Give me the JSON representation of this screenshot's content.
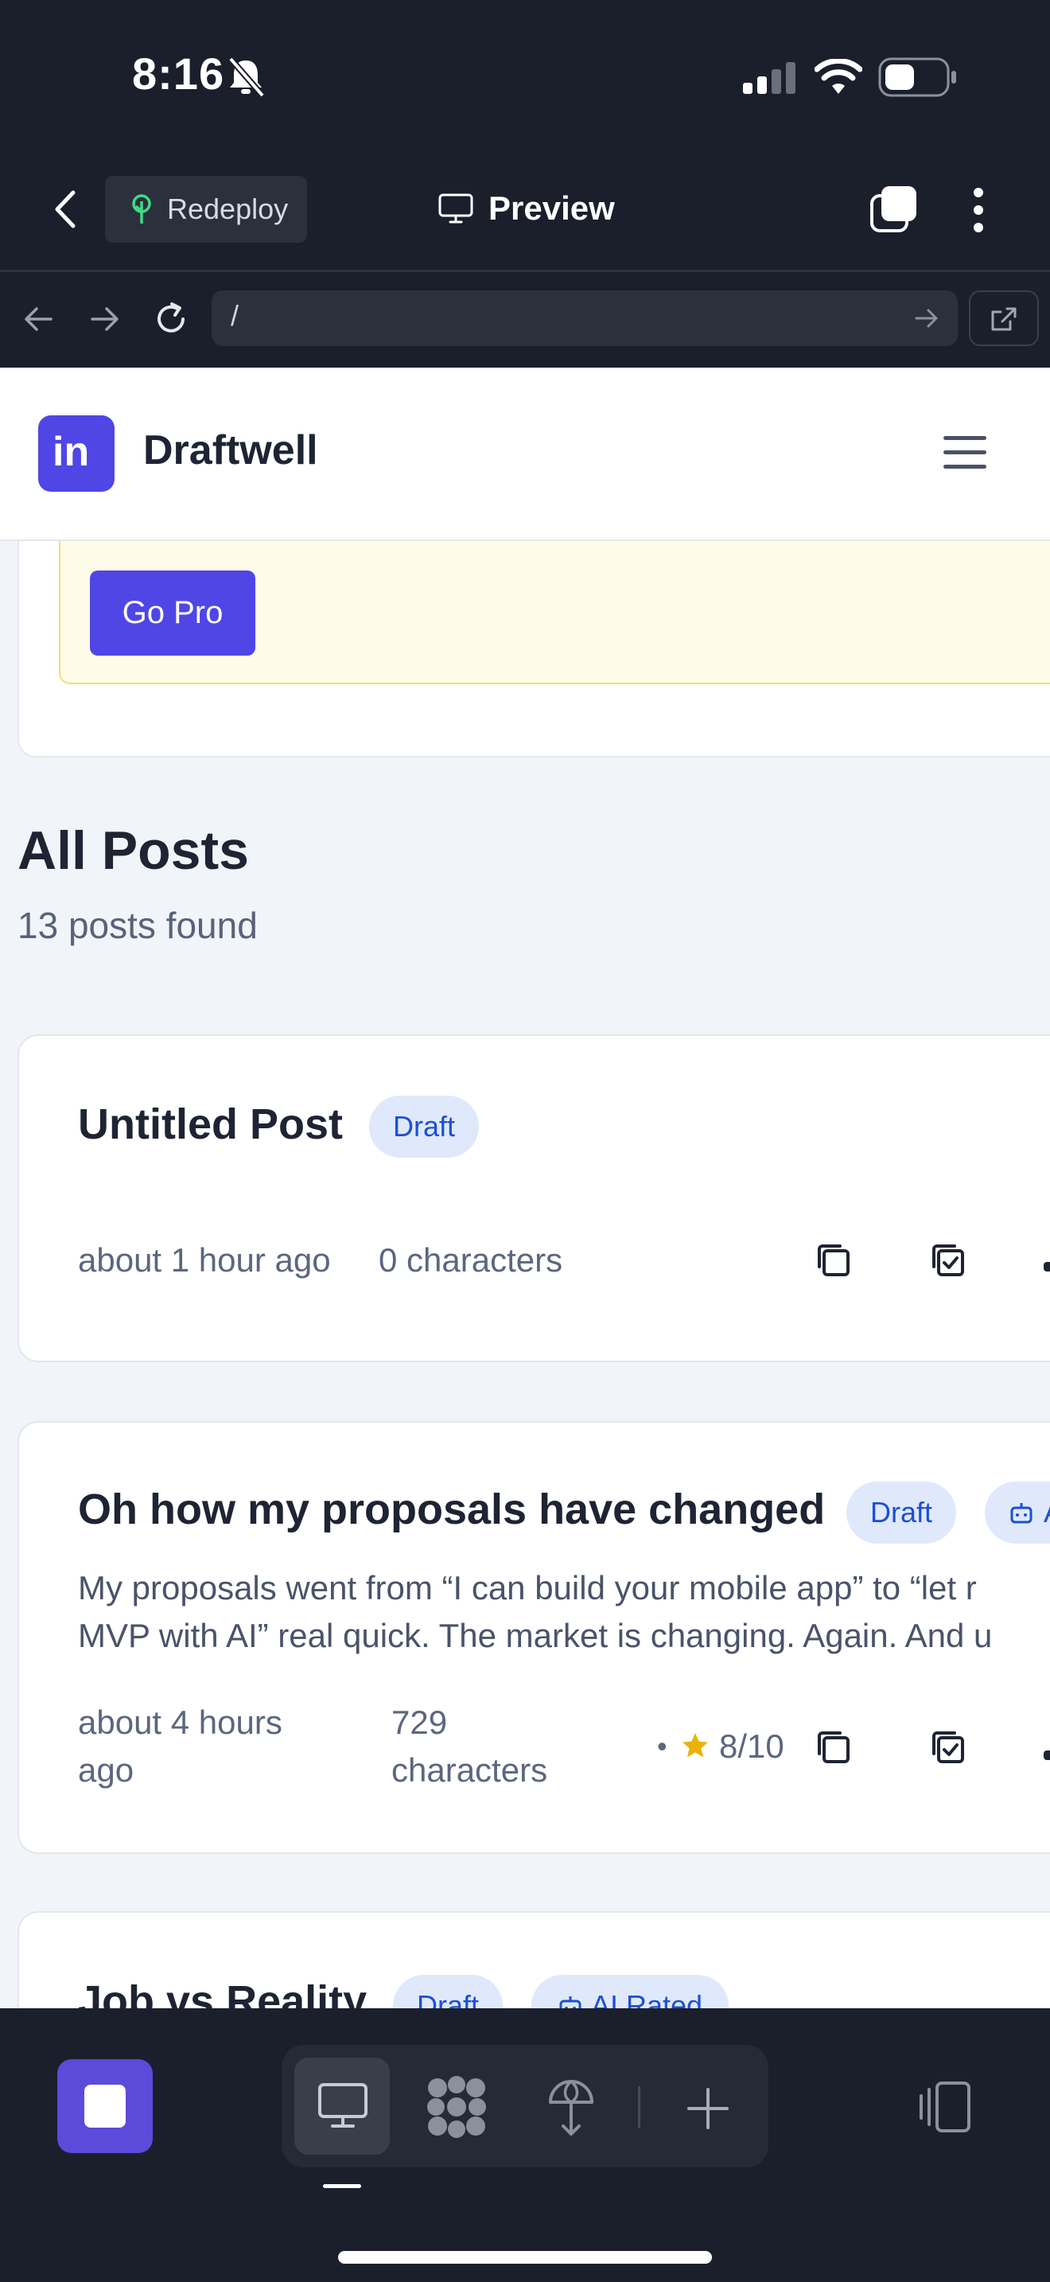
{
  "status_bar": {
    "time": "8:16"
  },
  "app_bar": {
    "redeploy_label": "Redeploy",
    "preview_label": "Preview"
  },
  "browser": {
    "url": "/"
  },
  "site": {
    "brand": "Draftwell",
    "logo_text": "in"
  },
  "pro_banner": {
    "button_label": "Go Pro"
  },
  "posts_section": {
    "title": "All Posts",
    "count_text": "13 posts found"
  },
  "posts": [
    {
      "title": "Untitled Post",
      "status": "Draft",
      "time": "about 1 hour ago",
      "chars": "0 characters"
    },
    {
      "title": "Oh how my proposals have changed",
      "status": "Draft",
      "ai_badge": "A",
      "excerpt_line1": "My proposals went from “I can build your mobile app” to “let r",
      "excerpt_line2": "MVP with AI” real quick. The market is changing. Again. And u",
      "time_line1": "about 4 hours",
      "time_line2": "ago",
      "chars_line1": "729",
      "chars_line2": "characters",
      "bullet": "•",
      "rating": "8/10"
    },
    {
      "title": "Job vs Reality",
      "status": "Draft",
      "ai_badge": "AI Rated"
    }
  ],
  "colors": {
    "accent": "#4f46e5",
    "badge_bg": "#dfe9fb",
    "badge_text": "#1d4fd6",
    "star": "#eab308",
    "dark_chrome": "#1b1f2c"
  },
  "icons": [
    "bell-slash-icon",
    "signal-icon",
    "wifi-icon",
    "battery-icon",
    "back-chevron-icon",
    "tree-icon",
    "monitor-icon",
    "tabs-icon",
    "more-icon",
    "arrow-left-icon",
    "arrow-right-icon",
    "reload-icon",
    "go-arrow-icon",
    "external-link-icon",
    "menu-icon",
    "copy-icon",
    "copy-check-icon",
    "robot-icon",
    "star-icon",
    "grid-icon",
    "globe-icon",
    "plus-icon",
    "device-icon"
  ]
}
